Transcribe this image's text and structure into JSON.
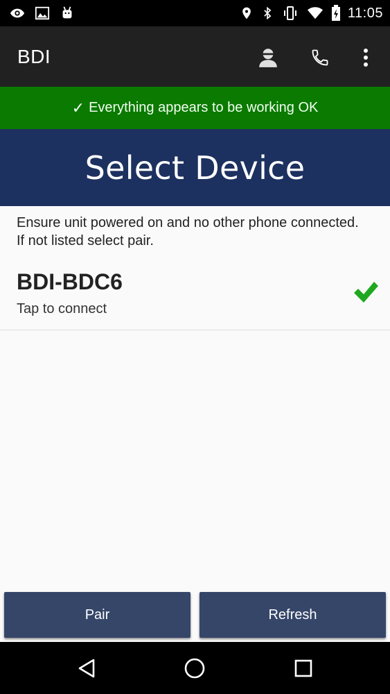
{
  "status_bar": {
    "time": "11:05",
    "left_icons": [
      "eye-icon",
      "image-icon",
      "android-icon"
    ],
    "right_icons": [
      "location-icon",
      "bluetooth-icon",
      "vibrate-icon",
      "wifi-icon",
      "battery-charging-icon"
    ]
  },
  "app_bar": {
    "title": "BDI",
    "actions": [
      "account-icon",
      "phone-icon",
      "overflow-menu-icon"
    ]
  },
  "banner": {
    "check": "✓",
    "text": "Everything appears to be working OK",
    "color": "#0a7a00"
  },
  "header": {
    "title": "Select Device",
    "color": "#1d3160"
  },
  "instructions": "Ensure unit powered on and no other phone connected. If not listed select pair.",
  "devices": [
    {
      "name": "BDI-BDC6",
      "subtitle": "Tap to connect",
      "status_icon": "checkmark-icon",
      "status_color": "#1fa81f"
    }
  ],
  "buttons": {
    "pair": "Pair",
    "refresh": "Refresh",
    "color": "#354669"
  },
  "nav_bar": [
    "back-icon",
    "home-icon",
    "recents-icon"
  ]
}
